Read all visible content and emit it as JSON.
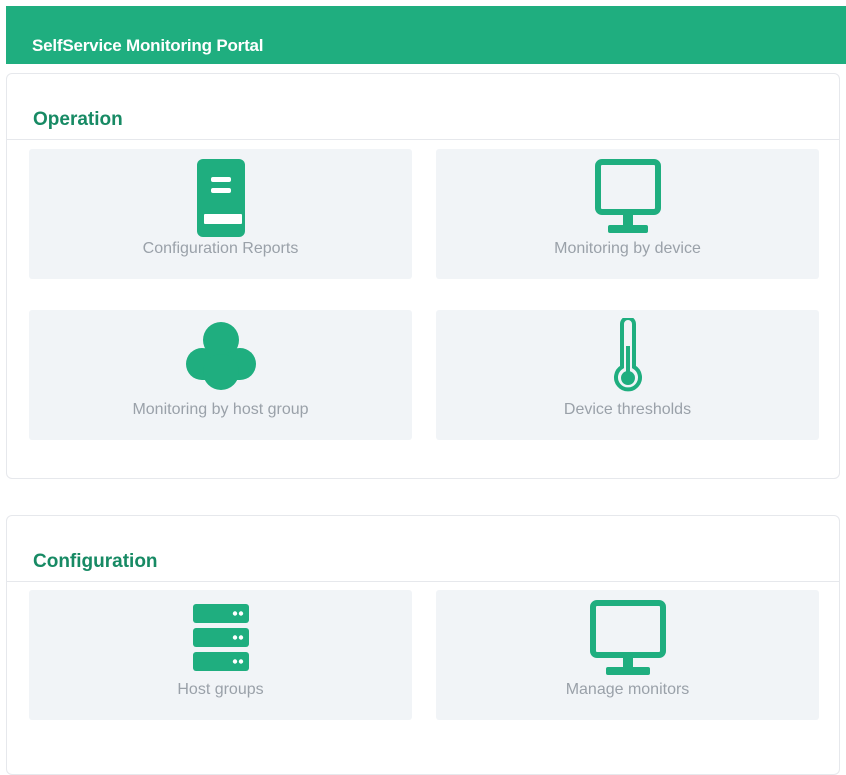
{
  "header": {
    "title": "SelfService Monitoring Portal"
  },
  "colors": {
    "brand": "#1fae7f",
    "heading": "#178a64",
    "tile_bg": "#f1f4f7",
    "label": "#9aa1a9"
  },
  "sections": [
    {
      "heading": "Operation",
      "tiles": [
        {
          "label": "Configuration Reports",
          "icon": "book-icon"
        },
        {
          "label": "Monitoring by device",
          "icon": "monitor-icon"
        },
        {
          "label": "Monitoring by host group",
          "icon": "cloud-icon"
        },
        {
          "label": "Device thresholds",
          "icon": "thermometer-icon"
        }
      ]
    },
    {
      "heading": "Configuration",
      "tiles": [
        {
          "label": "Host groups",
          "icon": "server-icon"
        },
        {
          "label": "Manage monitors",
          "icon": "monitor-icon"
        }
      ]
    }
  ]
}
